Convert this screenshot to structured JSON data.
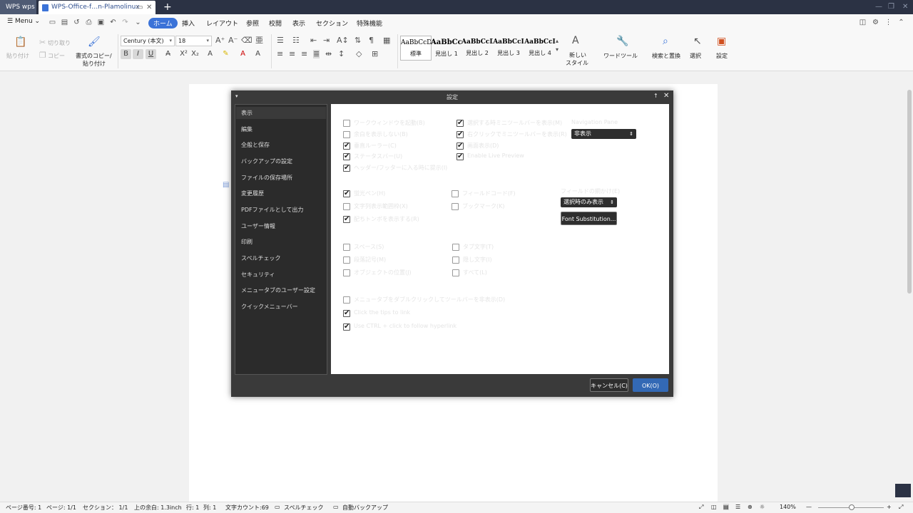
{
  "tabs": {
    "app_tab": "WPS wps",
    "doc_tab": "WPS-Office-f…n-Plamolinux",
    "colors": {
      "tabbar": "#2b3244",
      "accent": "#3b73d8"
    }
  },
  "menu": {
    "menu_label": "Menu",
    "tabs": [
      "ホーム",
      "挿入",
      "レイアウト",
      "参照",
      "校閲",
      "表示",
      "セクション",
      "特殊機能"
    ]
  },
  "ribbon": {
    "cut": "切り取り",
    "copy": "コピー",
    "paste": "貼り付け",
    "format_painter_1": "書式のコピー/",
    "format_painter_2": "貼り付け",
    "font_name": "Century (本文)",
    "font_size": "18",
    "styles": [
      {
        "preview": "AaBbCcDd",
        "name": "標準"
      },
      {
        "preview": "AaBbCcI",
        "name": "見出し 1"
      },
      {
        "preview": "AaBbCcD",
        "name": "見出し 2"
      },
      {
        "preview": "AaBbCcI",
        "name": "見出し 3"
      },
      {
        "preview": "AaBbCcI",
        "name": "見出し 4"
      }
    ],
    "new_style_1": "新しい",
    "new_style_2": "スタイル",
    "word_tool": "ワードツール",
    "find_replace": "検索と置換",
    "select": "選択",
    "settings": "設定"
  },
  "dialog": {
    "title": "設定",
    "nav": [
      "表示",
      "編集",
      "全般と保存",
      "バックアップの設定",
      "ファイルの保存場所",
      "変更履歴",
      "PDFファイルとして出力",
      "ユーザー情報",
      "印刷",
      "スペルチェック",
      "セキュリティ",
      "メニュータブのユーザー設定",
      "クイックメニューバー"
    ],
    "options": {
      "o1": "ワークウィンドウを起動(B)",
      "o2": "余白を表示しない(B)",
      "o3": "垂直ルーラー(C)",
      "o4": "ステータスバー(U)",
      "o5": "ヘッダー/フッターに入る時に提示(I)",
      "o6": "選択する時ミニツールバーを表示(M)",
      "o7": "右クリックでミニツールバーを表示(R)",
      "o8": "画面表示(D)",
      "o9": "Enable Live Preview",
      "nav_pane_label": "Navigation Pane",
      "nav_pane_value": "非表示",
      "o10": "蛍光ペン(H)",
      "o11": "文字列表示範囲枠(X)",
      "o12": "配ちトンボを表示する(R)",
      "o13": "フィールドコード(F)",
      "o14": "ブックマーク(K)",
      "field_shade_label": "フィールドの網かけ(E)",
      "field_shade_value": "選択時のみ表示",
      "font_sub_button": "Font Substitution...",
      "o15": "スペース(S)",
      "o16": "段落記号(M)",
      "o17": "オブジェクトの位置(J)",
      "o18": "タブ文字(T)",
      "o19": "隠し文字(I)",
      "o20": "すべて(L)",
      "o21": "メニュータブをダブルクリックしてツールバーを非表示(D)",
      "o22": "Click the tips to link",
      "o23": "Use CTRL + click to follow hyperlink"
    },
    "cancel": "キャンセル(C)",
    "ok": "OK(O)",
    "colors": {
      "frame": "#3a3a3a",
      "ok": "#3369b5"
    }
  },
  "status": {
    "page_no": "ページ番号: 1",
    "pages": "ページ: 1/1",
    "section": "セクション： 1/1",
    "top_margin": "上の余白: 1.3inch",
    "row": "行: 1",
    "col": "列: 1",
    "word_count": "文字カウント:69",
    "spellcheck": "スペルチェック",
    "autobackup": "自動バックアップ",
    "zoom": "140%"
  }
}
